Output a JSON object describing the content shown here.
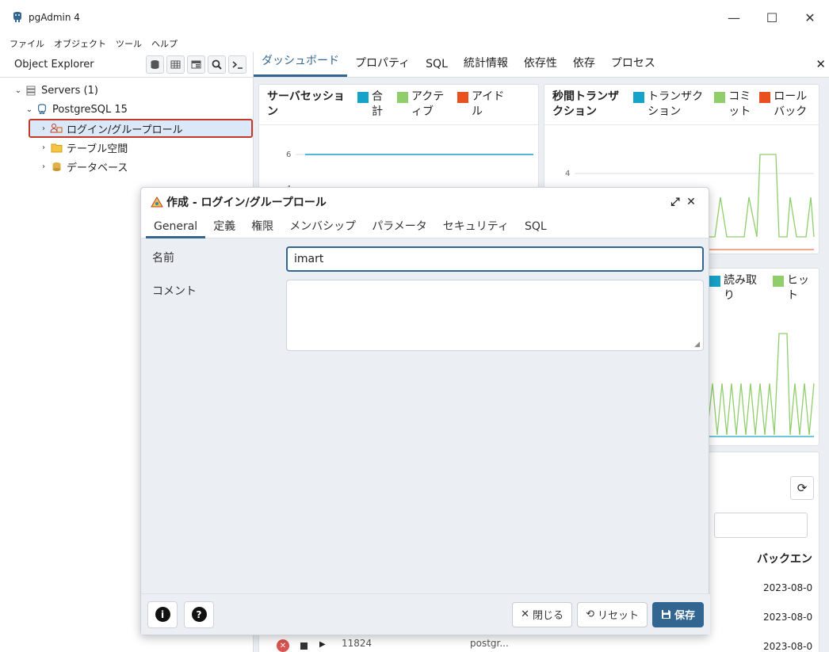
{
  "window": {
    "title": "pgAdmin 4",
    "minimize": "—",
    "maximize": "☐",
    "close": "✕"
  },
  "menu": [
    "ファイル",
    "オブジェクト",
    "ツール",
    "ヘルプ"
  ],
  "explorer": {
    "title": "Object Explorer",
    "tree": {
      "servers": "Servers (1)",
      "postgres": "PostgreSQL 15",
      "roles": "ログイン/グループロール",
      "tablespaces": "テーブル空間",
      "databases": "データベース"
    }
  },
  "dashboard": {
    "tabs": [
      "ダッシュボード",
      "プロパティ",
      "SQL",
      "統計情報",
      "依存性",
      "依存",
      "プロセス"
    ],
    "session_panel": {
      "title": "サーバセッション",
      "legend": [
        "合計",
        "アクティブ",
        "アイドル"
      ],
      "ticks": [
        "6",
        "4"
      ]
    },
    "tps_panel": {
      "title": "秒間トランザクション",
      "legend": [
        "トランザクション",
        "コミット",
        "ロールバック"
      ],
      "ticks": [
        "4"
      ]
    },
    "io_panel": {
      "legend": [
        "読み取り",
        "ヒット"
      ]
    },
    "activity": {
      "col_header": "バックエン",
      "dates": [
        "2023-08-0",
        "2023-08-0",
        "2023-08-0"
      ],
      "pid": "11824",
      "user": "postgr..."
    }
  },
  "dialog": {
    "title": "作成 - ログイン/グループロール",
    "tabs": [
      "General",
      "定義",
      "権限",
      "メンバシップ",
      "パラメータ",
      "セキュリティ",
      "SQL"
    ],
    "fields": {
      "name_label": "名前",
      "name_value": "imart",
      "comment_label": "コメント"
    },
    "footer": {
      "info": "i",
      "help": "?",
      "close": "閉じる",
      "reset": "リセット",
      "save": "保存"
    }
  },
  "colors": {
    "accent": "#326690",
    "legend_blue": "#17a2c8",
    "legend_green": "#8fce6b",
    "legend_red": "#e8511f"
  }
}
